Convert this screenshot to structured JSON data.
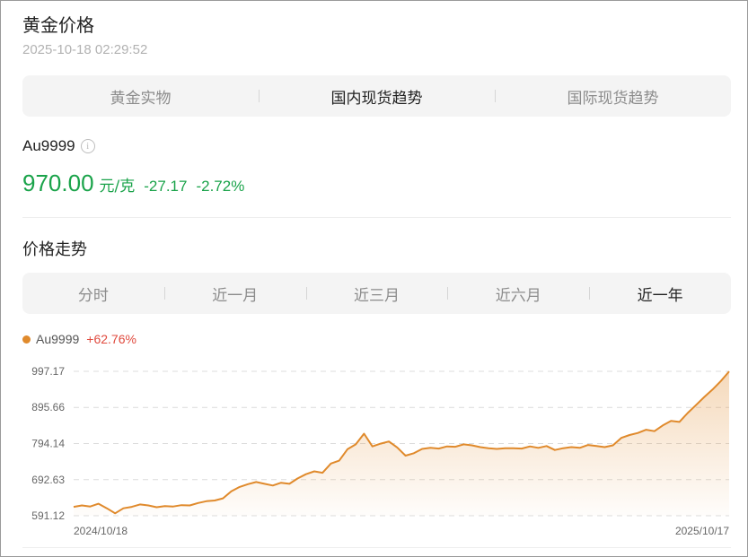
{
  "header": {
    "title": "黄金价格",
    "timestamp": "2025-10-18 02:29:52"
  },
  "top_tabs": [
    {
      "label": "黄金实物",
      "active": false
    },
    {
      "label": "国内现货趋势",
      "active": true
    },
    {
      "label": "国际现货趋势",
      "active": false
    }
  ],
  "quote": {
    "symbol": "Au9999",
    "info_icon": "info-icon",
    "price": "970.00",
    "unit": "元/克",
    "change": "-27.17",
    "change_pct": "-2.72%",
    "down_color": "#1aa34a"
  },
  "trend": {
    "section_title": "价格走势",
    "range_tabs": [
      {
        "label": "分时",
        "active": false
      },
      {
        "label": "近一月",
        "active": false
      },
      {
        "label": "近三月",
        "active": false
      },
      {
        "label": "近六月",
        "active": false
      },
      {
        "label": "近一年",
        "active": true
      }
    ],
    "legend": {
      "name": "Au9999",
      "change_pct": "+62.76%",
      "series_color": "#e08a2c",
      "up_color": "#e04a3e"
    }
  },
  "chart_data": {
    "type": "area",
    "title": "",
    "xlabel": "",
    "ylabel": "",
    "y_ticks": [
      "997.17",
      "895.66",
      "794.14",
      "692.63",
      "591.12"
    ],
    "ylim": [
      591.12,
      997.17
    ],
    "x_tick_labels": [
      "2024/10/18",
      "2025/10/17"
    ],
    "grid": true,
    "series": [
      {
        "values": [
          616,
          620,
          617,
          625,
          612,
          598,
          612,
          616,
          623,
          620,
          615,
          618,
          617,
          621,
          620,
          627,
          632,
          634,
          640,
          660,
          672,
          680,
          686,
          681,
          676,
          684,
          681,
          696,
          708,
          716,
          712,
          738,
          746,
          778,
          792,
          822,
          786,
          794,
          800,
          783,
          760,
          767,
          779,
          782,
          780,
          786,
          785,
          792,
          789,
          784,
          781,
          779,
          781,
          781,
          780,
          786,
          782,
          787,
          776,
          781,
          784,
          782,
          790,
          787,
          784,
          789,
          810,
          818,
          824,
          833,
          829,
          845,
          858,
          855,
          880,
          902,
          925,
          946,
          970,
          997
        ]
      }
    ]
  }
}
